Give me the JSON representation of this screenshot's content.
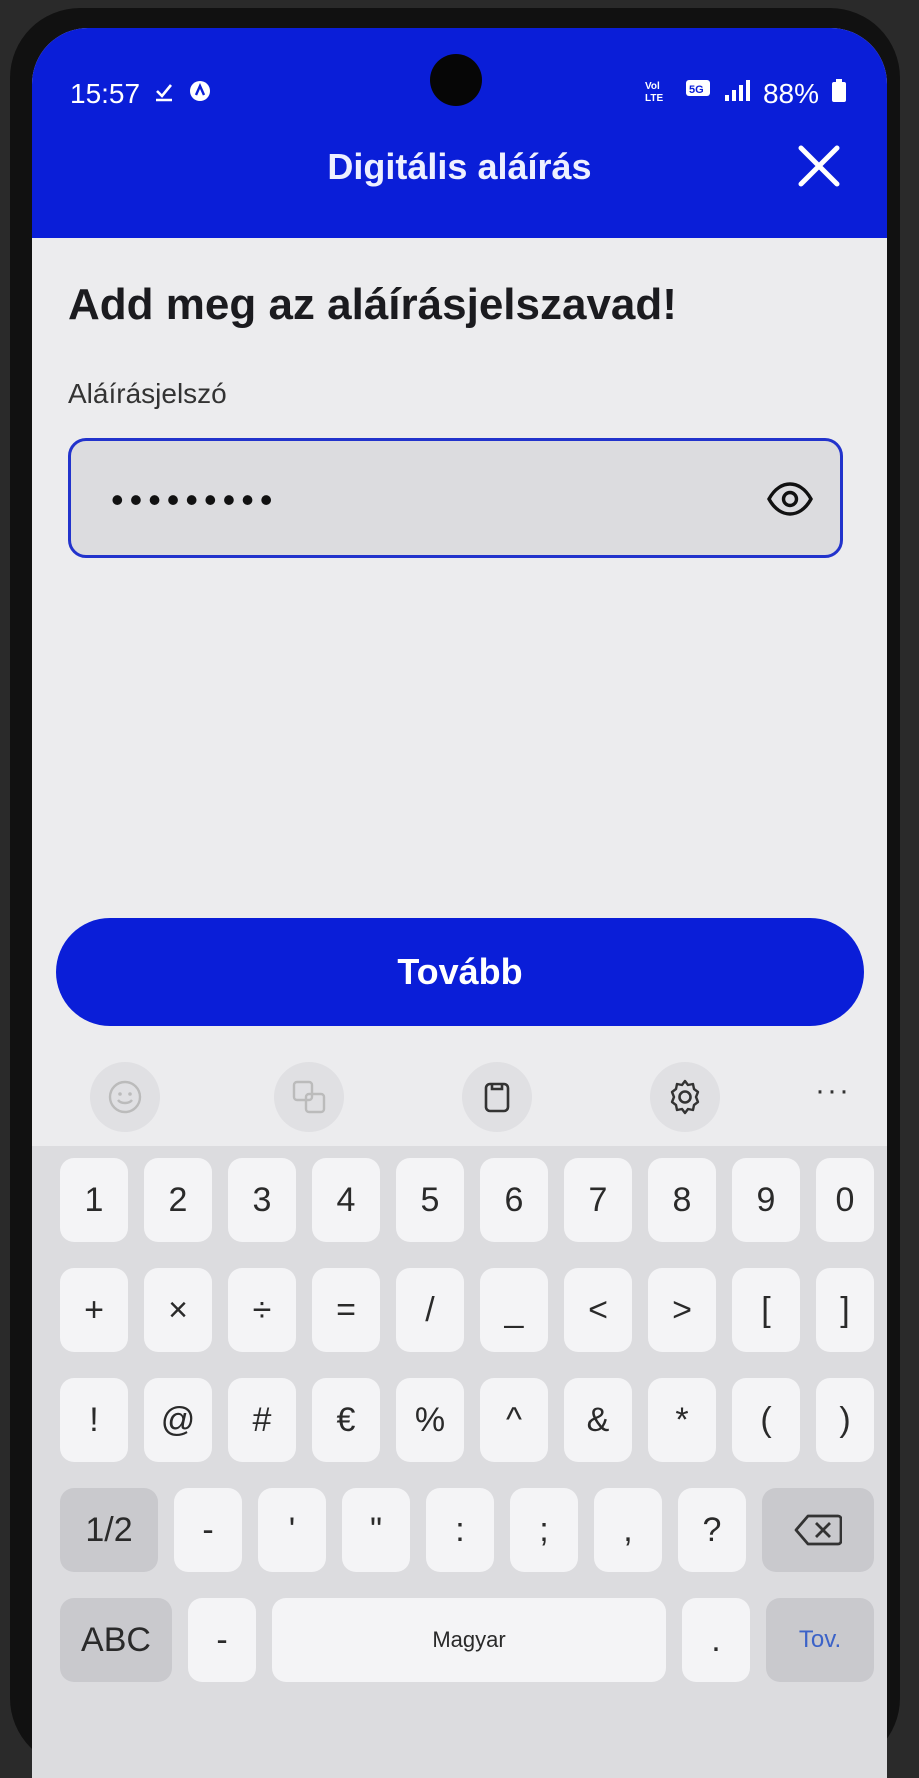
{
  "status_bar": {
    "time": "15:57",
    "battery": "88%"
  },
  "app_bar": {
    "title": "Digitális aláírás"
  },
  "form": {
    "heading": "Add meg az aláírásjelszavad!",
    "field_label": "Aláírásjelszó",
    "masked_value": "•••••••••"
  },
  "cta": {
    "label": "Tovább"
  },
  "keyboard_toolbar": {
    "more": "···"
  },
  "keyboard": {
    "row1": [
      "1",
      "2",
      "3",
      "4",
      "5",
      "6",
      "7",
      "8",
      "9",
      "0"
    ],
    "row2": [
      "+",
      "×",
      "÷",
      "=",
      "/",
      "_",
      "<",
      ">",
      "[",
      "]"
    ],
    "row3": [
      "!",
      "@",
      "#",
      "€",
      "%",
      "^",
      "&",
      "*",
      "(",
      ")"
    ],
    "row4": [
      "1/2",
      "-",
      "'",
      "\"",
      ":",
      ";",
      ",",
      "?"
    ],
    "row5": [
      "ABC",
      "-",
      "Magyar",
      ".",
      "Tov."
    ]
  },
  "colors": {
    "brand_blue": "#0a1ed8",
    "field_border": "#2233cc"
  }
}
